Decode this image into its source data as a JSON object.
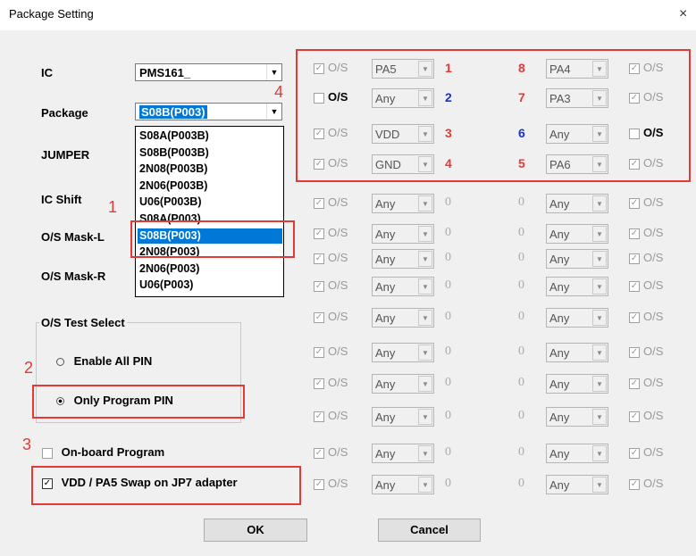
{
  "window": {
    "title": "Package Setting",
    "close_glyph": "×"
  },
  "labels": {
    "ic": "IC",
    "package": "Package",
    "jumper": "JUMPER",
    "ic_shift": "IC Shift",
    "os_mask_l": "O/S Mask-L",
    "os_mask_r": "O/S Mask-R"
  },
  "ic_combo": {
    "value": "PMS161_"
  },
  "package_combo": {
    "value": "S08B(P003)"
  },
  "package_list": {
    "items": [
      "S08A(P003B)",
      "S08B(P003B)",
      "2N08(P003B)",
      "2N06(P003B)",
      "U06(P003B)",
      "S08A(P003)",
      "S08B(P003)",
      "2N08(P003)",
      "2N06(P003)",
      "U06(P003)"
    ],
    "selected_index": 6
  },
  "os_test": {
    "legend": "O/S Test Select",
    "opt_all": "Enable All PIN",
    "opt_program": "Only Program PIN",
    "selected": "Only Program PIN"
  },
  "onboard": {
    "label": "On-board Program",
    "checked": false
  },
  "vdd_swap": {
    "label": "VDD / PA5 Swap on JP7 adapter",
    "checked": true
  },
  "buttons": {
    "ok": "OK",
    "cancel": "Cancel"
  },
  "annotations": {
    "n1": "1",
    "n2": "2",
    "n3": "3",
    "n4": "4"
  },
  "check_mark": "✓",
  "pin_rows": [
    {
      "left_os_label": "O/S",
      "left_os_checked": true,
      "left_os_enabled": false,
      "left_combo": "PA5",
      "left_num": "1",
      "left_num_color": "red",
      "right_num": "8",
      "right_num_color": "red",
      "right_combo": "PA4",
      "right_os_label": "O/S",
      "right_os_checked": true,
      "right_os_enabled": false
    },
    {
      "left_os_label": "O/S",
      "left_os_checked": false,
      "left_os_enabled": true,
      "left_combo": "Any",
      "left_num": "2",
      "left_num_color": "blue",
      "right_num": "7",
      "right_num_color": "red",
      "right_combo": "PA3",
      "right_os_label": "O/S",
      "right_os_checked": true,
      "right_os_enabled": false
    },
    {
      "left_os_label": "O/S",
      "left_os_checked": true,
      "left_os_enabled": false,
      "left_combo": "VDD",
      "left_num": "3",
      "left_num_color": "red",
      "right_num": "6",
      "right_num_color": "blue",
      "right_combo": "Any",
      "right_os_label": "O/S",
      "right_os_checked": false,
      "right_os_enabled": true
    },
    {
      "left_os_label": "O/S",
      "left_os_checked": true,
      "left_os_enabled": false,
      "left_combo": "GND",
      "left_num": "4",
      "left_num_color": "red",
      "right_num": "5",
      "right_num_color": "red",
      "right_combo": "PA6",
      "right_os_label": "O/S",
      "right_os_checked": true,
      "right_os_enabled": false
    },
    {
      "left_os_label": "O/S",
      "left_os_checked": true,
      "left_os_enabled": false,
      "left_combo": "Any",
      "left_num": "0",
      "left_num_color": "gray",
      "right_num": "0",
      "right_num_color": "gray",
      "right_combo": "Any",
      "right_os_label": "O/S",
      "right_os_checked": true,
      "right_os_enabled": false
    },
    {
      "left_os_label": "O/S",
      "left_os_checked": true,
      "left_os_enabled": false,
      "left_combo": "Any",
      "left_num": "0",
      "left_num_color": "gray",
      "right_num": "0",
      "right_num_color": "gray",
      "right_combo": "Any",
      "right_os_label": "O/S",
      "right_os_checked": true,
      "right_os_enabled": false
    },
    {
      "left_os_label": "O/S",
      "left_os_checked": true,
      "left_os_enabled": false,
      "left_combo": "Any",
      "left_num": "0",
      "left_num_color": "gray",
      "right_num": "0",
      "right_num_color": "gray",
      "right_combo": "Any",
      "right_os_label": "O/S",
      "right_os_checked": true,
      "right_os_enabled": false
    },
    {
      "left_os_label": "O/S",
      "left_os_checked": true,
      "left_os_enabled": false,
      "left_combo": "Any",
      "left_num": "0",
      "left_num_color": "gray",
      "right_num": "0",
      "right_num_color": "gray",
      "right_combo": "Any",
      "right_os_label": "O/S",
      "right_os_checked": true,
      "right_os_enabled": false
    },
    {
      "left_os_label": "O/S",
      "left_os_checked": true,
      "left_os_enabled": false,
      "left_combo": "Any",
      "left_num": "0",
      "left_num_color": "gray",
      "right_num": "0",
      "right_num_color": "gray",
      "right_combo": "Any",
      "right_os_label": "O/S",
      "right_os_checked": true,
      "right_os_enabled": false
    },
    {
      "left_os_label": "O/S",
      "left_os_checked": true,
      "left_os_enabled": false,
      "left_combo": "Any",
      "left_num": "0",
      "left_num_color": "gray",
      "right_num": "0",
      "right_num_color": "gray",
      "right_combo": "Any",
      "right_os_label": "O/S",
      "right_os_checked": true,
      "right_os_enabled": false
    },
    {
      "left_os_label": "O/S",
      "left_os_checked": true,
      "left_os_enabled": false,
      "left_combo": "Any",
      "left_num": "0",
      "left_num_color": "gray",
      "right_num": "0",
      "right_num_color": "gray",
      "right_combo": "Any",
      "right_os_label": "O/S",
      "right_os_checked": true,
      "right_os_enabled": false
    },
    {
      "left_os_label": "O/S",
      "left_os_checked": true,
      "left_os_enabled": false,
      "left_combo": "Any",
      "left_num": "0",
      "left_num_color": "gray",
      "right_num": "0",
      "right_num_color": "gray",
      "right_combo": "Any",
      "right_os_label": "O/S",
      "right_os_checked": true,
      "right_os_enabled": false
    },
    {
      "left_os_label": "O/S",
      "left_os_checked": true,
      "left_os_enabled": false,
      "left_combo": "Any",
      "left_num": "0",
      "left_num_color": "gray",
      "right_num": "0",
      "right_num_color": "gray",
      "right_combo": "Any",
      "right_os_label": "O/S",
      "right_os_checked": true,
      "right_os_enabled": false
    },
    {
      "left_os_label": "O/S",
      "left_os_checked": true,
      "left_os_enabled": false,
      "left_combo": "Any",
      "left_num": "0",
      "left_num_color": "gray",
      "right_num": "0",
      "right_num_color": "gray",
      "right_combo": "Any",
      "right_os_label": "O/S",
      "right_os_checked": true,
      "right_os_enabled": false
    }
  ]
}
